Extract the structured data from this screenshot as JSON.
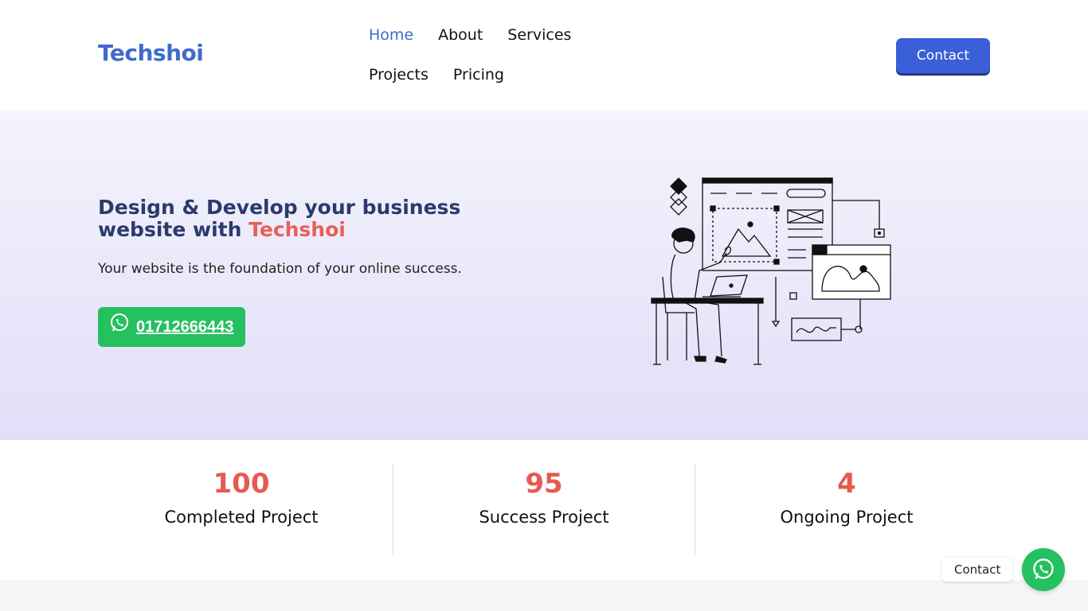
{
  "brand": {
    "name": "Techshoi",
    "color": "#3f6bcb"
  },
  "nav": {
    "items": [
      "Home",
      "About",
      "Services",
      "Projects",
      "Pricing"
    ],
    "active": "Home"
  },
  "header": {
    "contact_label": "Contact"
  },
  "hero": {
    "title_main": "Design & Develop your business website with ",
    "title_accent": "Techshoi",
    "subtitle": "Your website is the foundation of your online success.",
    "phone": "01712666443",
    "illustration_icon": "web-design-illustration"
  },
  "stats": [
    {
      "value": "100",
      "label": "Completed Project"
    },
    {
      "value": "95",
      "label": "Success Project"
    },
    {
      "value": "4",
      "label": "Ongoing Project"
    }
  ],
  "floating": {
    "label": "Contact",
    "icon": "whatsapp-icon"
  },
  "colors": {
    "accent": "#e8605a",
    "primary": "#3b5fd9",
    "whatsapp": "#25c05f"
  }
}
